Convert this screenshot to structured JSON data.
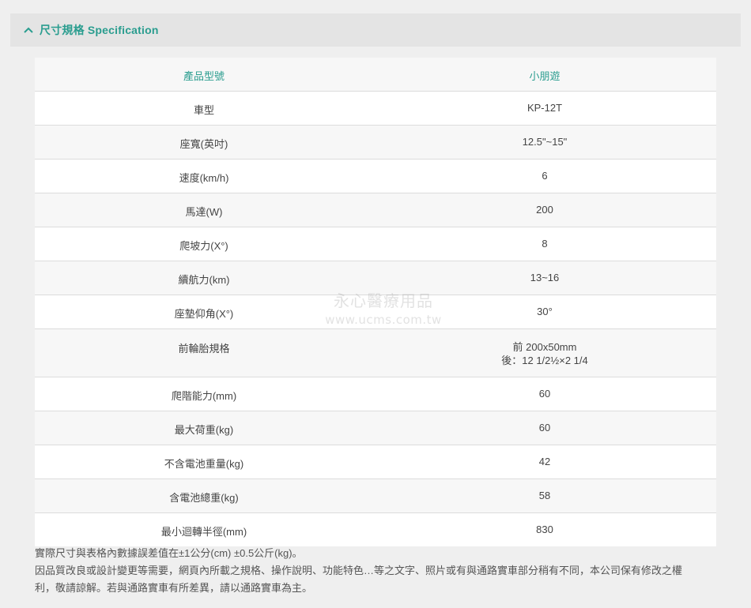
{
  "section": {
    "title": "尺寸規格 Specification",
    "toggle_icon": "chevron-up-icon",
    "accent_color": "#2a9d8f"
  },
  "spec_table": {
    "header": {
      "label": "產品型號",
      "value": "小朋遊"
    },
    "rows": [
      {
        "label": "車型",
        "value": "KP-12T"
      },
      {
        "label": "座寬(英吋)",
        "value": "12.5\"~15\""
      },
      {
        "label": "速度(km/h)",
        "value": "6"
      },
      {
        "label": "馬達(W)",
        "value": "200"
      },
      {
        "label": "爬坡力(X°)",
        "value": "8"
      },
      {
        "label": "續航力(km)",
        "value": "13~16"
      },
      {
        "label": "座墊仰角(X°)",
        "value": "30°"
      },
      {
        "label": "前輪胎規格",
        "value_line1": "前 200x50mm",
        "value_line2": "後：12 1/2½×2 1/4"
      },
      {
        "label": "爬階能力(mm)",
        "value": "60"
      },
      {
        "label": "最大荷重(kg)",
        "value": "60"
      },
      {
        "label": "不含電池重量(kg)",
        "value": "42"
      },
      {
        "label": "含電池總重(kg)",
        "value": "58"
      },
      {
        "label": "最小迴轉半徑(mm)",
        "value": "830"
      }
    ]
  },
  "watermark": {
    "line1": "永心醫療用品",
    "line2": "www.ucms.com.tw"
  },
  "notes": {
    "line1": "實際尺寸與表格內數據誤差值在±1公分(cm) ±0.5公斤(kg)。",
    "line2": "因品質改良或設計變更等需要，網頁內所載之規格、操作說明、功能特色…等之文字、照片或有與通路實車部分稍有不同，本公司保有修改之權",
    "line3": "利，敬請諒解。若與通路實車有所差異，請以通路實車為主。"
  }
}
